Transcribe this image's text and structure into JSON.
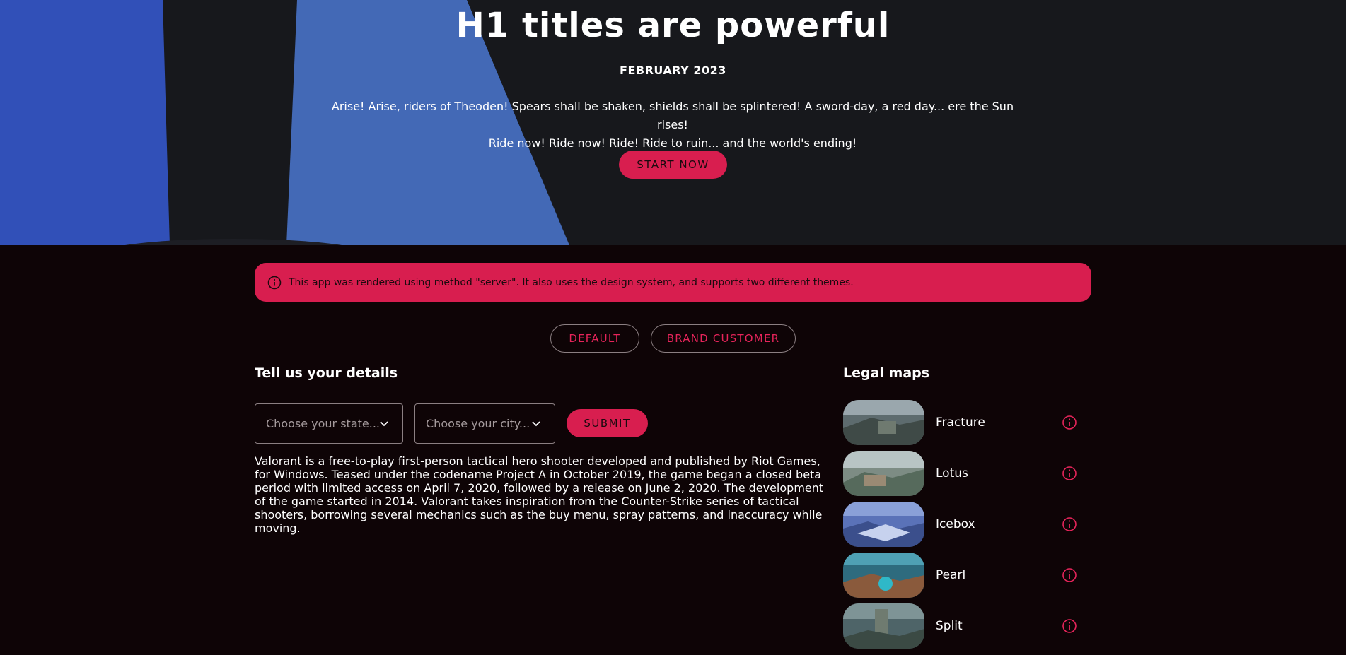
{
  "hero": {
    "title": "H1 titles are powerful",
    "date": "FEBRUARY 2023",
    "text_line1": "Arise! Arise, riders of Theoden! Spears shall be shaken, shields shall be splintered! A sword-day, a red day... ere the Sun rises!",
    "text_line2": "Ride now! Ride now! Ride! Ride to ruin... and the world's ending!",
    "cta_label": "START NOW"
  },
  "alert": {
    "icon": "info-icon",
    "text": "This app was rendered using method \"server\". It also uses the design system, and supports two different themes."
  },
  "themes": {
    "default_label": "DEFAULT",
    "brand_label": "BRAND CUSTOMER"
  },
  "details": {
    "title": "Tell us your details",
    "state_placeholder": "Choose your state...",
    "city_placeholder": "Choose your city...",
    "submit_label": "SUBMIT",
    "description": "Valorant is a free-to-play first-person tactical hero shooter developed and published by Riot Games, for Windows. Teased under the codename Project A in October 2019, the game began a closed beta period with limited access on April 7, 2020, followed by a release on June 2, 2020. The development of the game started in 2014. Valorant takes inspiration from the Counter-Strike series of tactical shooters, borrowing several mechanics such as the buy menu, spray patterns, and inaccuracy while moving."
  },
  "maps": {
    "title": "Legal maps",
    "items": [
      {
        "name": "Fracture",
        "icon": "info-icon"
      },
      {
        "name": "Lotus",
        "icon": "info-icon"
      },
      {
        "name": "Icebox",
        "icon": "info-icon"
      },
      {
        "name": "Pearl",
        "icon": "info-icon"
      },
      {
        "name": "Split",
        "icon": "info-icon"
      }
    ]
  },
  "colors": {
    "accent": "#d81e4f",
    "page_bg": "#0e0406",
    "hero_bg": "#17181c",
    "hero_blue": "#3e68b8"
  }
}
